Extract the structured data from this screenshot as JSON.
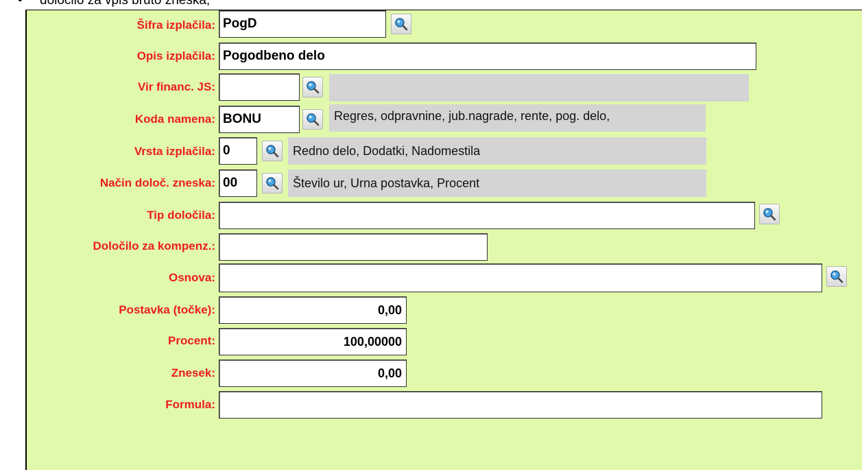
{
  "top_text": {
    "bullet": "•",
    "text": "določilo za vpis bruto zneska;"
  },
  "form": {
    "sifra_izplacila": {
      "label": "Šifra izplačila:",
      "value": "PogD"
    },
    "opis_izplacila": {
      "label": "Opis izplačila:",
      "value": "Pogodbeno delo"
    },
    "vir_financ": {
      "label": "Vir financ. JS:",
      "value": "",
      "description": ""
    },
    "koda_namena": {
      "label": "Koda namena:",
      "value": "BONU",
      "description": "Regres, odpravnine, jub.nagrade, rente, pog. delo,"
    },
    "vrsta_izplacila": {
      "label": "Vrsta izplačila:",
      "value": "0",
      "description": "Redno delo, Dodatki, Nadomestila"
    },
    "nacin_doloc": {
      "label": "Način določ. zneska:",
      "value": "00",
      "description": "Število ur, Urna postavka, Procent"
    },
    "tip_dolocila": {
      "label": "Tip določila:",
      "value": ""
    },
    "dolocilo_kompenz": {
      "label": "Določilo za kompenz.:",
      "value": ""
    },
    "osnova": {
      "label": "Osnova:",
      "value": ""
    },
    "postavka": {
      "label": "Postavka (točke):",
      "value": "0,00"
    },
    "procent": {
      "label": "Procent:",
      "value": "100,00000"
    },
    "znesek": {
      "label": "Znesek:",
      "value": "0,00"
    },
    "formula": {
      "label": "Formula:",
      "value": ""
    }
  },
  "icons": {
    "lookup": "magnifier-lookup-icon"
  },
  "colors": {
    "panel_bg": "#e1f9ab",
    "label": "#ec1c24",
    "description_bg": "#d4d4d4"
  }
}
